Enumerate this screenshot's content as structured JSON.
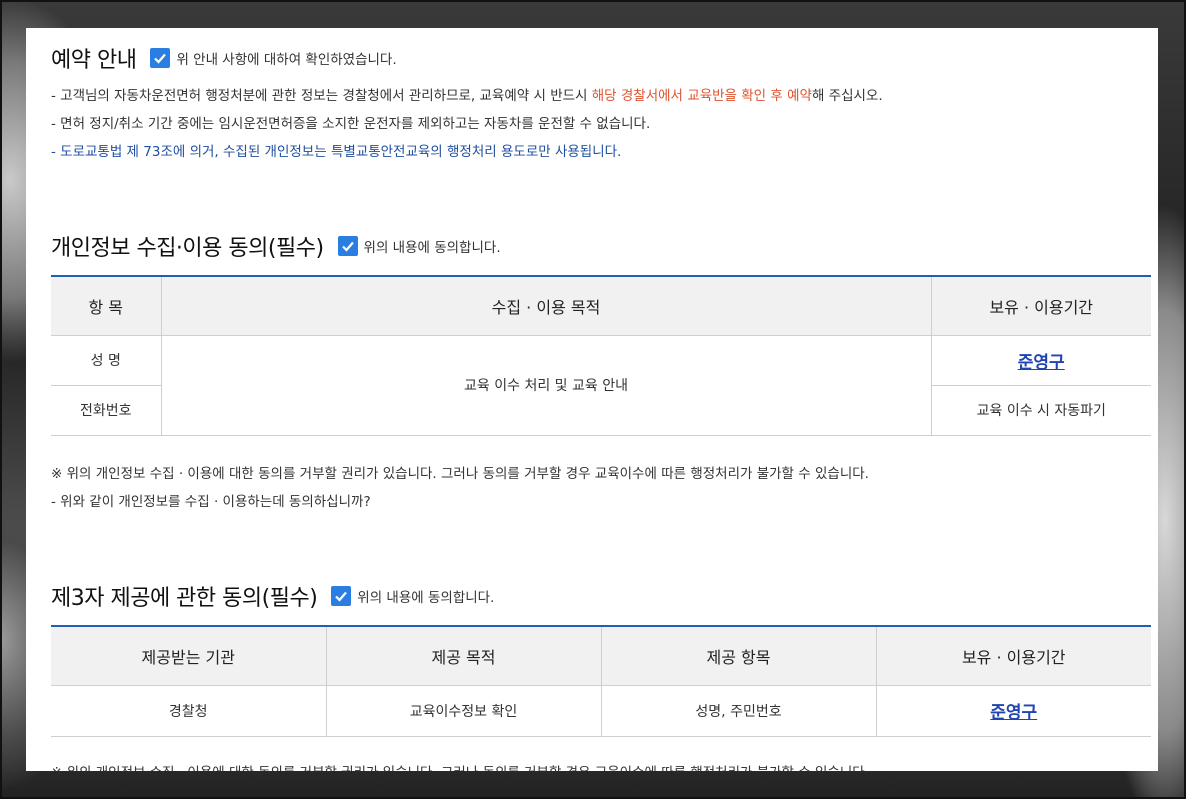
{
  "reservation": {
    "title": "예약 안내",
    "confirm_label": "위 안내 사항에 대하여 확인하였습니다.",
    "notice_1_pre": "- 고객님의 자동차운전면허 행정처분에 관한 정보는 경찰청에서 관리하므로, 교육예약 시 반드시 ",
    "notice_1_highlight": "해당 경찰서에서 교육반을 확인 후 예약",
    "notice_1_post": "해 주십시오.",
    "notice_2": "- 면허 정지/취소 기간 중에는 임시운전면허증을 소지한 운전자를 제외하고는 자동차를 운전할 수 없습니다.",
    "notice_3": "- 도로교통법 제 73조에 의거, 수집된 개인정보는 특별교통안전교육의 행정처리 용도로만 사용됩니다."
  },
  "personal": {
    "title": "개인정보 수집·이용 동의(필수)",
    "agree_label": "위의 내용에 동의합니다.",
    "headers": [
      "항 목",
      "수집 · 이용 목적",
      "보유 · 이용기간"
    ],
    "rows": [
      "성 명",
      "전화번호"
    ],
    "purpose": "교육 이수 처리 및 교육 안내",
    "retention_link": "준영구",
    "retention_2": "교육 이수 시 자동파기",
    "note_1": "※ 위의 개인정보 수집 · 이용에 대한 동의를 거부할 권리가 있습니다. 그러나 동의를 거부할 경우 교육이수에 따른 행정처리가 불가할 수 있습니다.",
    "note_2": "- 위와 같이 개인정보를 수집 · 이용하는데 동의하십니까?"
  },
  "third_party": {
    "title": "제3자 제공에 관한 동의(필수)",
    "agree_label": "위의 내용에 동의합니다.",
    "headers": [
      "제공받는 기관",
      "제공 목적",
      "제공 항목",
      "보유 · 이용기간"
    ],
    "row": [
      "경찰청",
      "교육이수정보 확인",
      "성명, 주민번호",
      "준영구"
    ],
    "note_1_partial": "※ 위의 개인정보 수집 · 이용에 대한 동의를 거부할 권리가 있습니다. 그러나 동의를 거부할 경우 교육이수에 따른 행정처리가 불가할 수 있습니다."
  },
  "colors": {
    "accent": "#2a7de1",
    "table_border": "#1f5fb8",
    "highlight": "#e0532f",
    "info_blue": "#1f4fa0",
    "link": "#1f45b0"
  }
}
